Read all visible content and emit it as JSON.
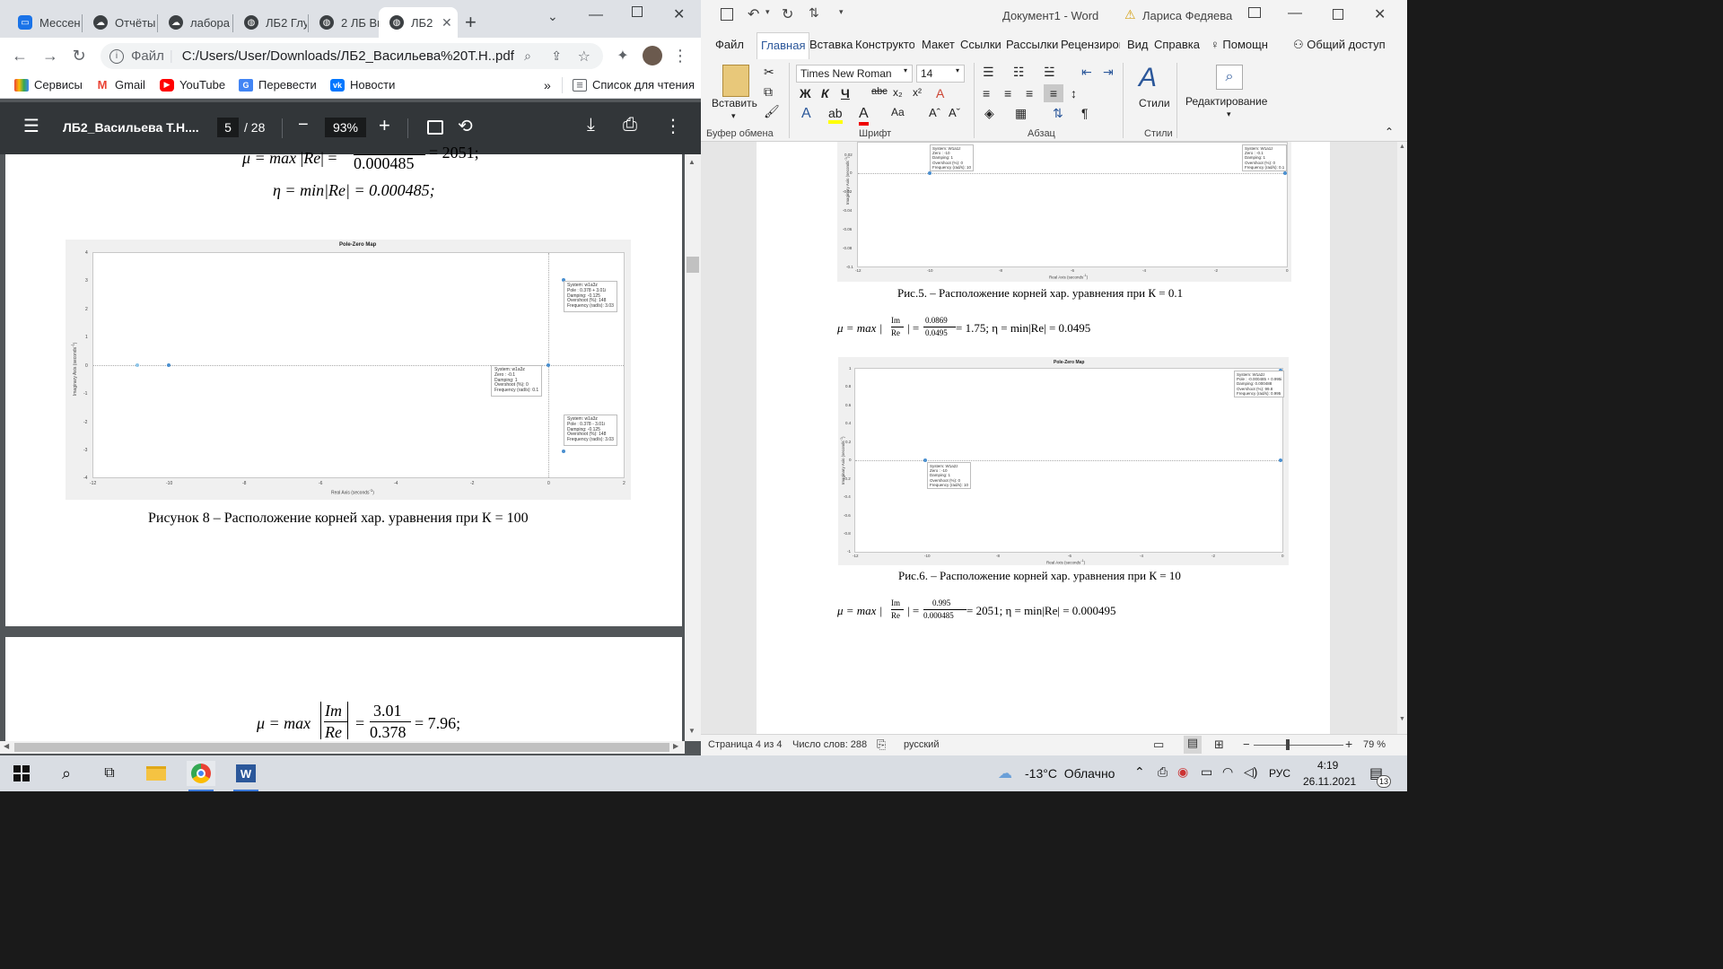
{
  "chrome": {
    "tabs": [
      {
        "label": "Мессен",
        "icon": "messenger-icon",
        "color": "#1a73e8"
      },
      {
        "label": "Отчёты",
        "icon": "cloud-icon",
        "color": "#3c4043"
      },
      {
        "label": "лабора",
        "icon": "cloud-icon",
        "color": "#3c4043"
      },
      {
        "label": "ЛБ2 Глу",
        "icon": "globe-icon",
        "color": "#3c4043"
      },
      {
        "label": "2 ЛБ Ви",
        "icon": "globe-icon",
        "color": "#3c4043"
      },
      {
        "label": "ЛБ2",
        "icon": "globe-icon",
        "color": "#3c4043"
      }
    ],
    "address": {
      "scheme": "Файл",
      "path": "C:/Users/User/Downloads/ЛБ2_Васильева%20Т.Н..pdf"
    },
    "bookmarks": [
      {
        "label": "Сервисы",
        "icon": "apps-icon"
      },
      {
        "label": "Gmail",
        "icon": "gmail-icon"
      },
      {
        "label": "YouTube",
        "icon": "youtube-icon"
      },
      {
        "label": "Перевести",
        "icon": "translate-icon"
      },
      {
        "label": "Новости",
        "icon": "vk-icon"
      }
    ],
    "reading_list": "Список для чтения",
    "more_bookmarks": "»"
  },
  "pdf": {
    "filename": "ЛБ2_Васильева Т.Н....",
    "page_current": "5",
    "page_total": "/ 28",
    "zoom": "93%",
    "eq_top_partial_left": "μ = max",
    "eq_top_partial_den": "Re",
    "eq_top_partial_frac_den": "0.000485",
    "eq_top_partial_result": "= 2051;",
    "eq_eta": "η = min|Re| = 0.000485;",
    "caption": "Рисунок 8 – Расположение корней хар. уравнения при К = 100",
    "eq_bottom": {
      "lhs": "μ = max",
      "num_sym": "Im",
      "den_sym": "Re",
      "num": "3.01",
      "den": "0.378",
      "result": "= 7.96;"
    }
  },
  "plot_pdf": {
    "title": "Pole-Zero Map",
    "xlabel": "Real Axis (seconds",
    "ylabel": "Imaginary Axis (seconds",
    "exp": "-1",
    "xticks": [
      "-12",
      "-10",
      "-8",
      "-6",
      "-4",
      "-2",
      "0",
      "2"
    ],
    "yticks": [
      "4",
      "3",
      "2",
      "1",
      "0",
      "-1",
      "-2",
      "-3",
      "-4"
    ],
    "tip_pole_top": [
      "System: w1a3z",
      "Pole : 0.378 + 3.01i",
      "Damping: -0.125",
      "Overshoot (%): 148",
      "Frequency (rad/s): 3.03"
    ],
    "tip_zero": [
      "System: w1a3z",
      "Zero : -0.1",
      "Damping: 1",
      "Overshoot (%): 0",
      "Frequency (rad/s): 0.1"
    ],
    "tip_pole_bottom": [
      "System: w1a3z",
      "Pole : 0.378 - 3.01i",
      "Damping: -0.125",
      "Overshoot (%): 148",
      "Frequency (rad/s): 3.03"
    ]
  },
  "word": {
    "title": "Документ1 - Word",
    "user": "Лариса Федяева",
    "tabs": [
      "Файл",
      "Главная",
      "Вставка",
      "Конструктор",
      "Макет",
      "Ссылки",
      "Рассылки",
      "Рецензирование",
      "Вид",
      "Справка",
      "Помощн",
      "Общий доступ"
    ],
    "font_name": "Times New Roman",
    "font_size": "14",
    "paste_label": "Вставить",
    "styles_label": "Стили",
    "editing_label": "Редактирование",
    "groups": [
      "Буфер обмена",
      "Шрифт",
      "Абзац",
      "Стили"
    ],
    "fig5_caption": "Рис.5. – Расположение корней хар. уравнения при К = 0.1",
    "eq5": {
      "lhs": "μ = max |",
      "num_sym": "Im",
      "den_sym": "Re",
      "mid": "| =",
      "num": "0.0869",
      "den": "0.0495",
      "rest": "= 1.75; η = min|Re| = 0.0495"
    },
    "fig6_caption": "Рис.6. – Расположение корней хар. уравнения при К = 10",
    "eq6": {
      "lhs": "μ = max |",
      "num_sym": "Im",
      "den_sym": "Re",
      "mid": "| =",
      "num": "0.995",
      "den": "0.000485",
      "rest": "= 2051; η = min|Re| = 0.000495"
    },
    "status": {
      "page": "Страница 4 из 4",
      "words": "Число слов: 288",
      "lang": "русский",
      "zoom": "79 %"
    }
  },
  "plot_w5": {
    "xlabel": "Real Axis (seconds",
    "ylabel": "Imaginary Axis (seconds",
    "exp": "-1",
    "xticks": [
      "-12",
      "-10",
      "-8",
      "-6",
      "-4",
      "-2",
      "0"
    ],
    "yticks": [
      "0.02",
      "0",
      "-0.02",
      "-0.04",
      "-0.06",
      "-0.08",
      "-0.1"
    ],
    "tip_left": [
      "System: W1a1z",
      "Zero : -10",
      "Damping: 1",
      "Overshoot (%): 0",
      "Frequency (rad/s): 10"
    ],
    "tip_right": [
      "System: W1a1z",
      "Zero : -0.1",
      "Damping: 1",
      "Overshoot (%): 0",
      "Frequency (rad/s): 0.1"
    ]
  },
  "plot_w6": {
    "title": "Pole-Zero Map",
    "xlabel": "Real Axis (seconds",
    "ylabel": "Imaginary Axis (seconds",
    "exp": "-1",
    "xticks": [
      "-12",
      "-10",
      "-8",
      "-6",
      "-4",
      "-2",
      "0"
    ],
    "yticks": [
      "1",
      "0.8",
      "0.6",
      "0.4",
      "0.2",
      "0",
      "-0.2",
      "-0.4",
      "-0.6",
      "-0.8",
      "-1"
    ],
    "tip_left": [
      "System: W1a2z",
      "Zero : -10",
      "Damping: 1",
      "Overshoot (%): 0",
      "Frequency (rad/s): 10"
    ],
    "tip_right": [
      "System: W1a2z",
      "Pole : -0.000485 + 0.995i",
      "Damping: 0.000488",
      "Overshoot (%): 99.8",
      "Frequency (rad/s): 0.995"
    ]
  },
  "taskbar": {
    "weather": "-13°C  Облачно",
    "lang": "РУС",
    "time": "4:19",
    "date": "26.11.2021",
    "notifications": "13"
  }
}
